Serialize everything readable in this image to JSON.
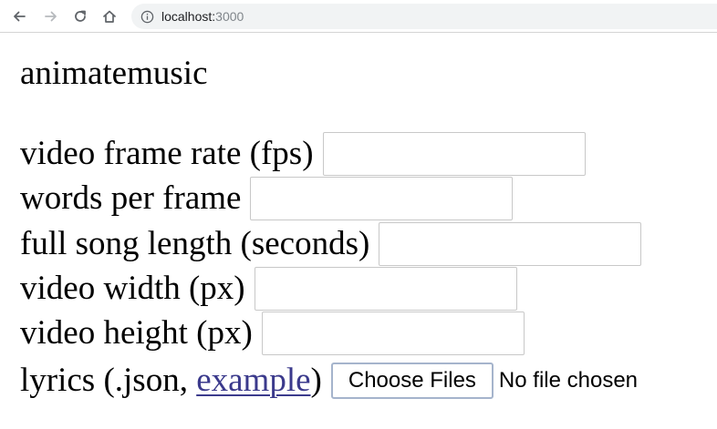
{
  "browser": {
    "url_host": "localhost:",
    "url_port": "3000",
    "icons": {
      "back": "arrow-left-icon",
      "forward": "arrow-right-icon",
      "reload": "reload-icon",
      "home": "home-icon",
      "info": "info-icon"
    }
  },
  "page": {
    "title": "animatemusic",
    "fields": [
      {
        "label": "video frame rate (fps)",
        "value": ""
      },
      {
        "label": "words per frame",
        "value": ""
      },
      {
        "label": "full song length (seconds)",
        "value": ""
      },
      {
        "label": "video width (px)",
        "value": ""
      },
      {
        "label": "video height (px)",
        "value": ""
      }
    ],
    "lyrics": {
      "label_prefix": "lyrics (.json, ",
      "link_text": "example",
      "label_suffix": ")",
      "button_label": "Choose Files",
      "status": "No file chosen"
    }
  },
  "colors": {
    "link": "#3b3a8c",
    "input_border": "#c8c8c8",
    "button_border": "#a5b4cc",
    "address_bar_bg": "#f1f3f4"
  }
}
